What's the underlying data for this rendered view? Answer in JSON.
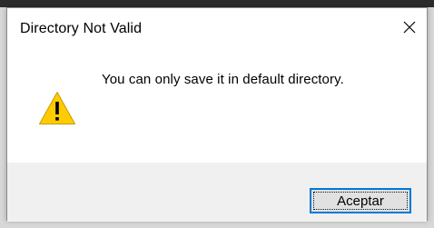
{
  "dialog": {
    "title": "Directory Not Valid",
    "message": "You can only save it in default directory.",
    "icon": "warning-icon",
    "close_icon": "close-icon",
    "ok_button_label": "Aceptar"
  },
  "colors": {
    "accent": "#0078d7",
    "warning_yellow": "#ffcc00",
    "footer_bg": "#f0f0f0"
  }
}
